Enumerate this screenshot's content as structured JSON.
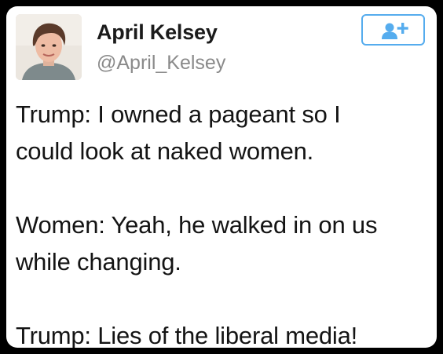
{
  "tweet": {
    "author": {
      "name": "April Kelsey",
      "handle": "@April_Kelsey",
      "avatar_icon": "profile-photo"
    },
    "follow_button": {
      "icon": "add-user-icon",
      "color": "#55acee"
    },
    "text_lines": [
      "Trump: I owned a pageant so I",
      "could look at naked women.",
      "Women: Yeah, he walked in on us",
      "while changing.",
      "Trump: Lies of the liberal media!"
    ]
  }
}
